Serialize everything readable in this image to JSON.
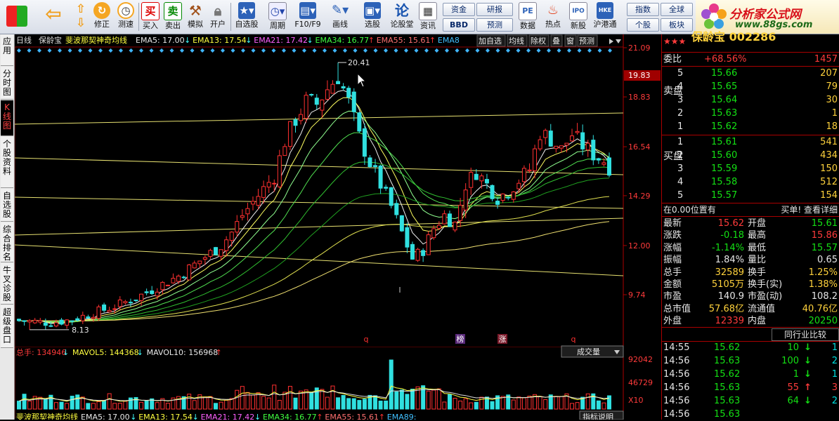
{
  "toolbar": {
    "buttons": [
      {
        "label": "",
        "icon": "windows-logo-icon"
      },
      {
        "label": "",
        "icon": "back-arrow-icon"
      },
      {
        "label": "",
        "icon": "up-down-arrows-icon"
      },
      {
        "label": "修正",
        "icon": "refresh-icon"
      },
      {
        "label": "测速",
        "icon": "clock-icon"
      },
      {
        "label": "买入",
        "icon": "buy-icon",
        "glyph": "买"
      },
      {
        "label": "卖出",
        "icon": "sell-icon",
        "glyph": "卖"
      },
      {
        "label": "模拟",
        "icon": "hammer-icon"
      },
      {
        "label": "开户",
        "icon": "lock-icon"
      },
      {
        "label": "自选股",
        "icon": "star-icon"
      },
      {
        "label": "周期",
        "icon": "clock-cycle-icon"
      },
      {
        "label": "F10/F9",
        "icon": "f10-icon"
      },
      {
        "label": "画线",
        "icon": "pencil-icon"
      },
      {
        "label": "选股",
        "icon": "screen-icon"
      },
      {
        "label": "论股堂",
        "icon": "forum-icon",
        "glyph": "论"
      },
      {
        "label": "资讯",
        "icon": "info-icon"
      },
      {
        "label": "数据",
        "icon": "pe-icon",
        "glyph": "PE"
      },
      {
        "label": "热点",
        "icon": "fire-icon"
      },
      {
        "label": "新股",
        "icon": "ipo-icon"
      },
      {
        "label": "沪港通",
        "icon": "hk-connect-icon"
      }
    ],
    "pair_buttons": [
      "资金",
      "研报",
      "BBD",
      "预测",
      "指数",
      "全球",
      "个股",
      "板块"
    ]
  },
  "brand": {
    "name": "分析家公式网",
    "url": "www.88gs.com"
  },
  "left_tabs": [
    {
      "label": "应用"
    },
    {
      "label": "分时图"
    },
    {
      "label": "K线图"
    },
    {
      "label": "个股资料"
    },
    {
      "label": "自选股"
    },
    {
      "label": "综合排名"
    },
    {
      "label": "牛叉诊股"
    },
    {
      "label": "超级盘口"
    }
  ],
  "chart": {
    "header": {
      "period": "日线",
      "stock": "保龄宝",
      "indicator": "斐波那契神奇均线",
      "items": [
        {
          "label": "EMA5: 17.00",
          "arrow": "↓"
        },
        {
          "label": "EMA13: 17.54",
          "arrow": "↓"
        },
        {
          "label": "EMA21: 17.42",
          "arrow": "↓"
        },
        {
          "label": "EMA34: 16.77",
          "arrow": "↑"
        },
        {
          "label": "EMA55: 15.61",
          "arrow": "↑"
        },
        {
          "label": "EMA8",
          "arrow": ""
        }
      ],
      "buttons": [
        "加自选",
        "均线",
        "除权",
        "叠",
        "窗",
        "预测"
      ]
    },
    "price_axis": [
      "21.09",
      "18.83",
      "16.54",
      "14.29",
      "12.00",
      "9.74"
    ],
    "current_price_tag": "19.83",
    "high_label": "20.41",
    "low_label": "8.13",
    "event_marks": [
      "q",
      "榜",
      "涨",
      "q"
    ],
    "volume_header": {
      "items": [
        {
          "label": "总手: 134946",
          "arrow": "↓"
        },
        {
          "label": "MAVOL5: 144368",
          "arrow": "↓"
        },
        {
          "label": "MAVOL10: 156968",
          "arrow": "↑"
        }
      ],
      "dropdown": "成交量"
    },
    "volume_axis": [
      "92042",
      "46729",
      "X10"
    ],
    "footer_items": [
      "斐波那契神奇均线",
      "EMA5: 17.00",
      "EMA13: 17.54",
      "EMA21: 17.42",
      "EMA34: 16.77",
      "EMA55: 15.61",
      "EMA89:"
    ],
    "footer_right": "指标说明"
  },
  "quote": {
    "title": "保龄宝 002286",
    "stars": "★★★",
    "weibi": {
      "label": "委比",
      "pct": "+68.56%",
      "val": "1457"
    },
    "sell": [
      {
        "lvl": "5",
        "price": "15.66",
        "vol": "207"
      },
      {
        "lvl": "4",
        "price": "15.65",
        "vol": "79"
      },
      {
        "lvl": "3",
        "price": "15.64",
        "vol": "30"
      },
      {
        "lvl": "2",
        "price": "15.63",
        "vol": "1"
      },
      {
        "lvl": "1",
        "price": "15.62",
        "vol": "18"
      }
    ],
    "buy": [
      {
        "lvl": "1",
        "price": "15.61",
        "vol": "541"
      },
      {
        "lvl": "2",
        "price": "15.60",
        "vol": "434"
      },
      {
        "lvl": "3",
        "price": "15.59",
        "vol": "150"
      },
      {
        "lvl": "4",
        "price": "15.58",
        "vol": "512"
      },
      {
        "lvl": "5",
        "price": "15.57",
        "vol": "154"
      }
    ],
    "sell_side": "卖盘",
    "buy_side": "买盘",
    "info_left": "在0.00位置有",
    "info_right": "买单! 查看详细",
    "stats": [
      {
        "k1": "最新",
        "v1": "15.62",
        "k2": "开盘",
        "v2": "15.61"
      },
      {
        "k1": "涨跌",
        "v1": "-0.18",
        "k2": "最高",
        "v2": "15.86"
      },
      {
        "k1": "涨幅",
        "v1": "-1.14%",
        "k2": "最低",
        "v2": "15.57"
      },
      {
        "k1": "振幅",
        "v1": "1.84%",
        "k2": "量比",
        "v2": "0.65"
      },
      {
        "k1": "总手",
        "v1": "32589",
        "k2": "换手",
        "v2": "1.25%"
      },
      {
        "k1": "金额",
        "v1": "5105万",
        "k2": "换手(实)",
        "v2": "1.38%"
      },
      {
        "k1": "市盈",
        "v1": "140.9",
        "k2": "市盈(动)",
        "v2": "108.2"
      },
      {
        "k1": "总市值",
        "v1": "57.68亿",
        "k2": "流通值",
        "v2": "40.76亿"
      },
      {
        "k1": "外盘",
        "v1": "12339",
        "k2": "内盘",
        "v2": "20250"
      }
    ],
    "compare_btn": "同行业比较",
    "ticks": [
      {
        "time": "14:55",
        "price": "15.62",
        "vol": "10",
        "dir": "↓",
        "n": "1"
      },
      {
        "time": "14:56",
        "price": "15.63",
        "vol": "100",
        "dir": "↓",
        "n": "2"
      },
      {
        "time": "14:56",
        "price": "15.62",
        "vol": "1",
        "dir": "↓",
        "n": "1"
      },
      {
        "time": "14:56",
        "price": "15.63",
        "vol": "55",
        "dir": "↑",
        "n": "3"
      },
      {
        "time": "14:56",
        "price": "15.63",
        "vol": "64",
        "dir": "↓",
        "n": "2"
      },
      {
        "time": "14:56",
        "price": "15.63",
        "vol": "",
        "dir": "",
        "n": ""
      }
    ]
  }
}
